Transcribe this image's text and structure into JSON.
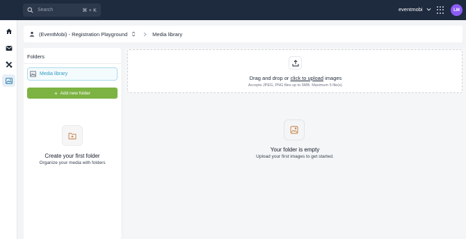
{
  "topbar": {
    "search_placeholder": "Search",
    "search_shortcut": "⌘ + K",
    "org_name": "eventmobi",
    "avatar_initials": "LM",
    "avatar_color": "#8b5cf6"
  },
  "rail": {
    "items": [
      {
        "icon": "home-icon",
        "active": false
      },
      {
        "icon": "inbox-icon",
        "active": false
      },
      {
        "icon": "tools-icon",
        "active": false
      },
      {
        "icon": "image-icon",
        "active": true
      }
    ]
  },
  "breadcrumb": {
    "event": "(EventMobi) - Registration Playground",
    "current": "Media library"
  },
  "folders": {
    "title": "Folders",
    "items": [
      {
        "label": "Media library",
        "selected": true
      }
    ],
    "add_label": "Add new folder",
    "empty_title": "Create your first folder",
    "empty_subtitle": "Organize your media with folders"
  },
  "dropzone": {
    "text_before": "Drag and drop or ",
    "link_text": "click to upload",
    "text_after": " images",
    "hint": "Accepts JPEG, PNG files up to 5MB. Maximum 5 file(s)."
  },
  "media": {
    "empty_title": "Your folder is empty",
    "empty_subtitle": "Upload your first images to get started."
  },
  "colors": {
    "topbar_bg": "#1e2a3e",
    "accent_green": "#7cb342",
    "selected_blue": "#2f9bc1"
  }
}
